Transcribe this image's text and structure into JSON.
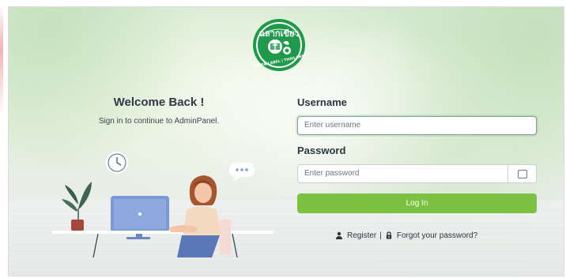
{
  "login": {
    "welcome_title": "Welcome Back !",
    "subtitle": "Sign in to continue to AdminPanel.",
    "username_label": "Username",
    "username_placeholder": "Enter username",
    "password_label": "Password",
    "password_placeholder": "Enter password",
    "login_button": "Log In",
    "register_link": "Register",
    "separator": "|",
    "forgot_link": "Forgot your password?"
  },
  "logo": {
    "thai_text": "ฉลากเขียว",
    "english_text": "GREEN LABEL | THAILAND",
    "color": "#1e9a4a"
  },
  "colors": {
    "accent_green": "#7dc143",
    "text_dark": "#2b3640"
  },
  "icons": {
    "register": "user-icon",
    "forgot": "lock-icon",
    "password_toggle": "eye-toggle-icon",
    "chat": "chat-bubble-icon",
    "clock": "clock-icon"
  }
}
